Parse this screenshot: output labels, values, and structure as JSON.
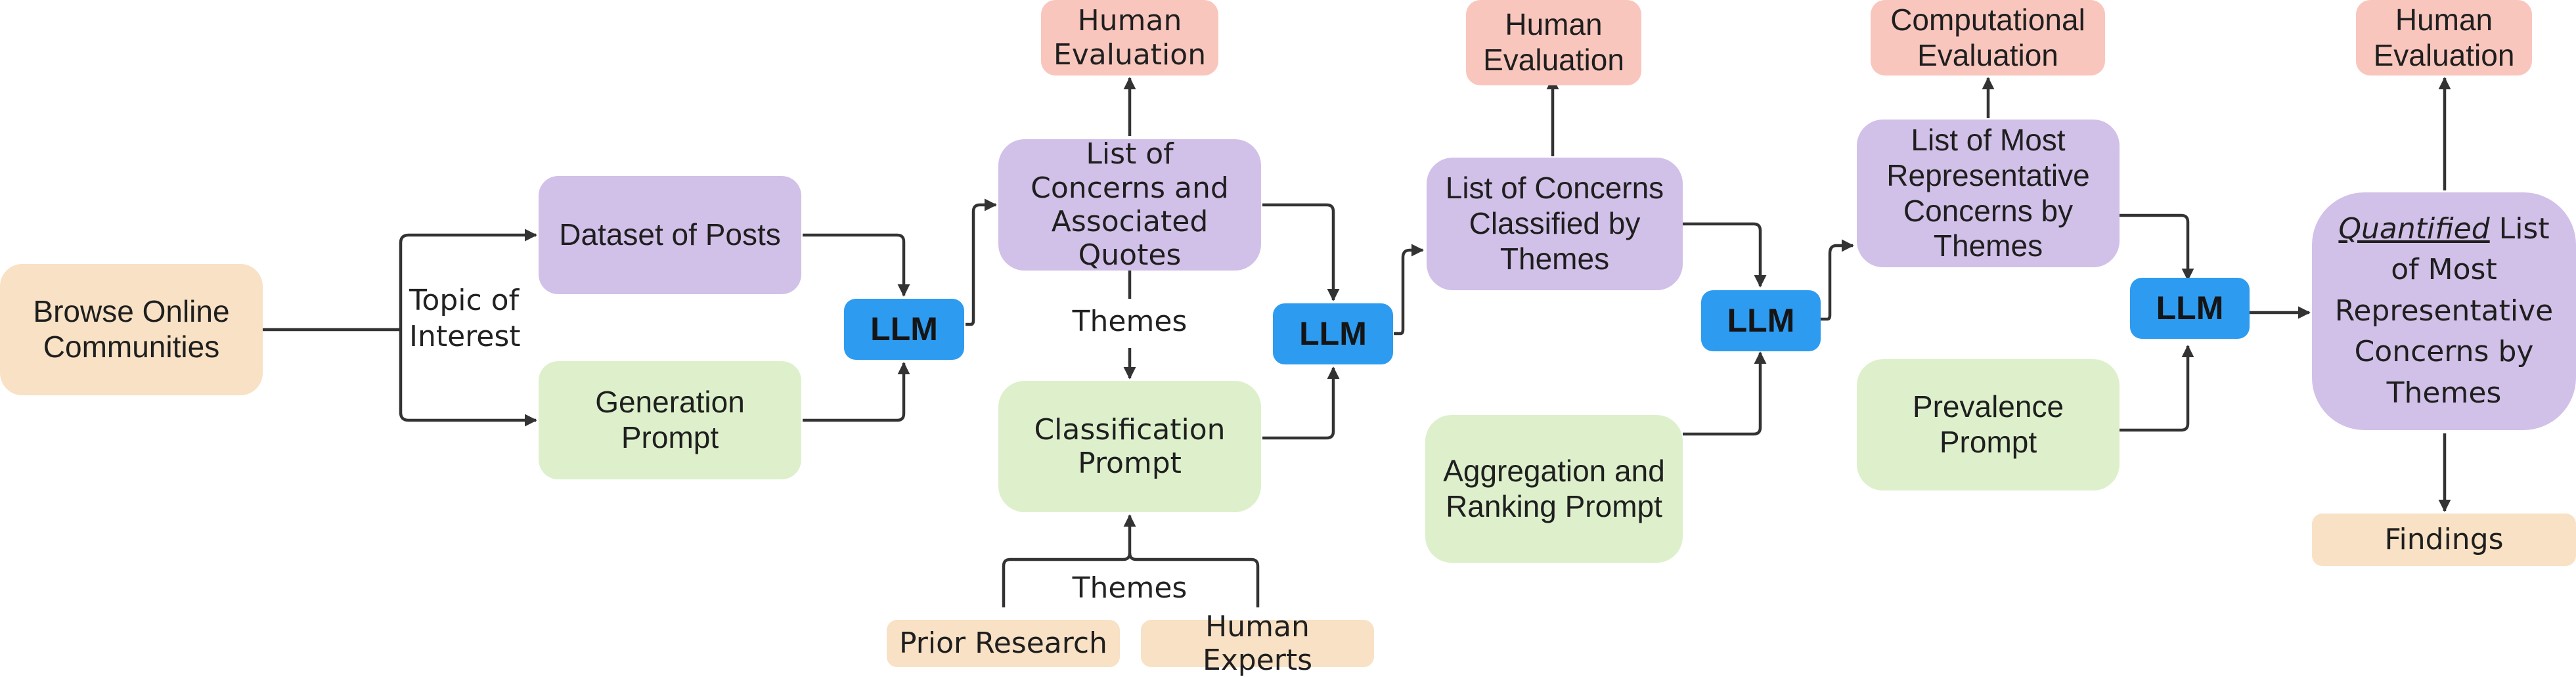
{
  "diagram": {
    "nodes": {
      "browse": "Browse Online Communities",
      "dataset": "Dataset of Posts",
      "generation_prompt": "Generation Prompt",
      "llm_1": "LLM",
      "concerns_quotes": "List of Concerns and Associated Quotes",
      "human_eval_1": "Human Evaluation",
      "classification_prompt": "Classification Prompt",
      "prior_research": "Prior Research",
      "human_experts": "Human Experts",
      "llm_2": "LLM",
      "concerns_classified": "List of Concerns Classified by Themes",
      "human_eval_2": "Human Evaluation",
      "aggregation_prompt": "Aggregation and Ranking Prompt",
      "llm_3": "LLM",
      "most_representative": "List of Most Representative Concerns by Themes",
      "computational_eval": "Computational Evaluation",
      "prevalence_prompt": "Prevalence Prompt",
      "llm_4": "LLM",
      "quantified_emph": "Quantified",
      "quantified_rest": " List of Most Representative Concerns by Themes",
      "human_eval_3": "Human Evaluation",
      "findings": "Findings"
    },
    "edge_labels": {
      "topic": "Topic of Interest",
      "themes_1": "Themes",
      "themes_2": "Themes"
    },
    "colors": {
      "source": "#f8e1c4",
      "artifact": "#d1c0e8",
      "prompt": "#ddf0cb",
      "evaluation": "#f9c6bd",
      "llm": "#2d9bf0",
      "edge": "#333333"
    }
  }
}
